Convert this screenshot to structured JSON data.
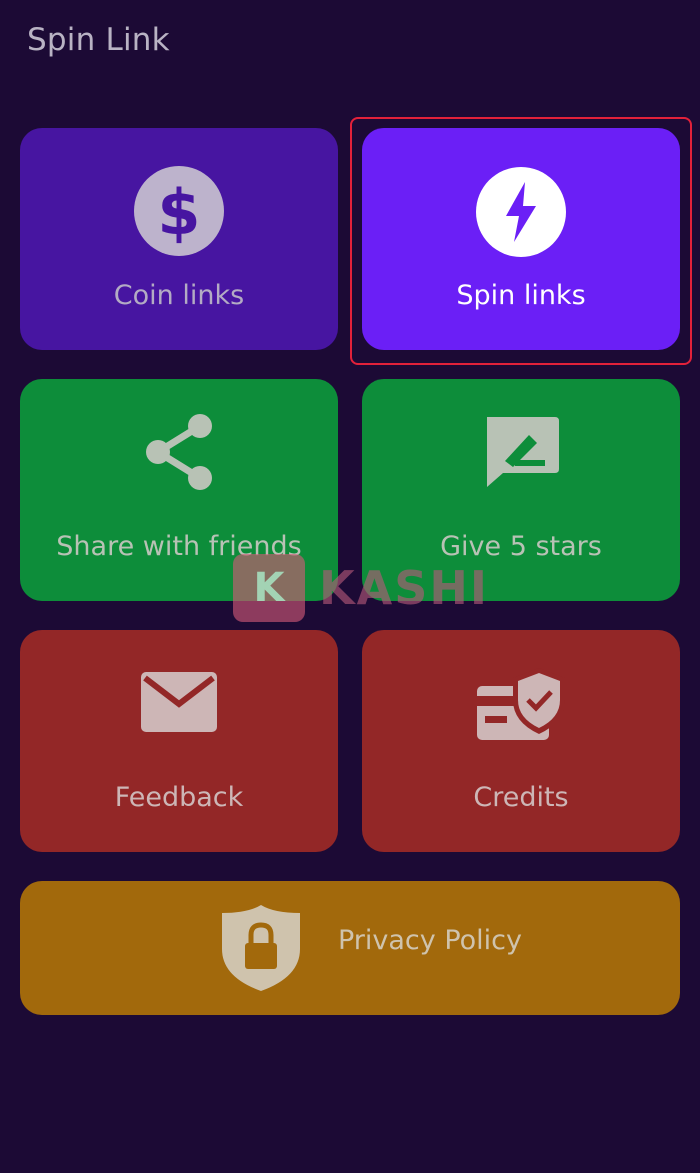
{
  "app": {
    "title": "Spin Link"
  },
  "menu": {
    "coin_links": {
      "label": "Coin links",
      "icon": "dollar-coin-icon"
    },
    "spin_links": {
      "label": "Spin links",
      "icon": "lightning-bolt-icon"
    },
    "share": {
      "label": "Share with friends",
      "icon": "share-icon"
    },
    "rate": {
      "label": "Give 5 stars",
      "icon": "rate-feedback-icon"
    },
    "feedback": {
      "label": "Feedback",
      "icon": "mail-icon"
    },
    "credits": {
      "label": "Credits",
      "icon": "card-shield-icon"
    },
    "privacy": {
      "label": "Privacy Policy",
      "icon": "shield-lock-icon"
    }
  },
  "watermark": {
    "badge": "K",
    "text": "KASHI"
  },
  "colors": {
    "background": "#1c0a35",
    "coin_tile": "#4715a1",
    "spin_tile": "#6b1ff6",
    "green_tile": "#0d8d3a",
    "red_tile": "#932727",
    "privacy_tile": "#a2690c",
    "highlight": "#e2213a"
  }
}
